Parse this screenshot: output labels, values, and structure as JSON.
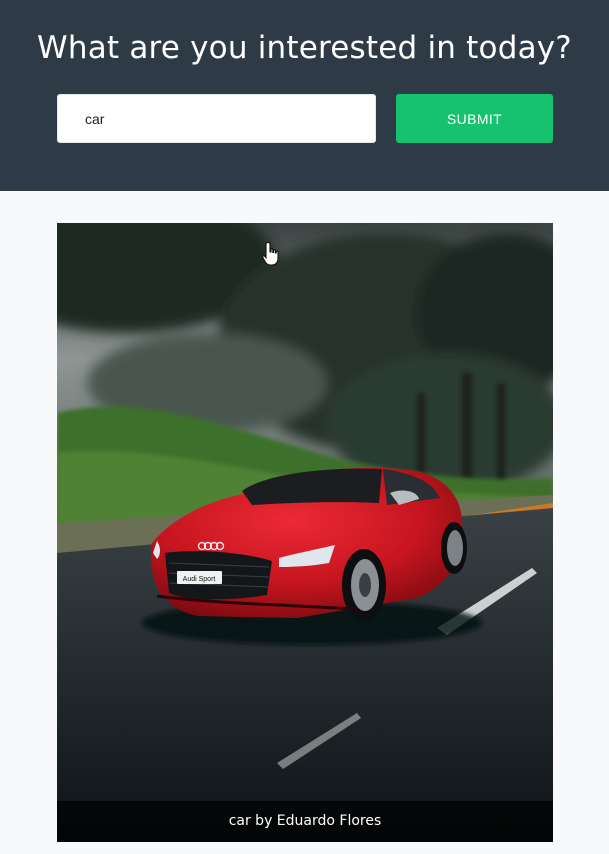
{
  "header": {
    "title": "What are you interested in today?",
    "background_color": "#2e3b47"
  },
  "search": {
    "value": "car",
    "submit_label": "SUBMIT",
    "submit_color": "#17c26e"
  },
  "result": {
    "caption": "car by Eduardo Flores",
    "image_subject": "red Audi TT RS sports car driving on a wet road past trees in fog",
    "plate_text": "Audi Sport"
  },
  "cursor": {
    "icon": "hand-pointer-icon"
  }
}
